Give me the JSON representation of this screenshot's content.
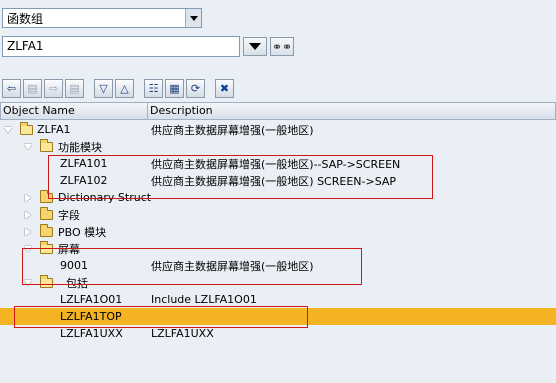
{
  "object_type": {
    "selected": "函数组"
  },
  "object_name": {
    "value": "ZLFA1"
  },
  "toolbar": {
    "icons": [
      "back-icon",
      "forward-dim-icon",
      "forward-icon",
      "forward-dim2-icon",
      "collapse-icon",
      "expand-icon",
      "hierarchy-icon",
      "display-icon",
      "refresh-icon",
      "close-icon"
    ]
  },
  "columns": {
    "name": "Object Name",
    "description": "Description"
  },
  "tree": {
    "root": {
      "name": "ZLFA1",
      "desc": "供应商主数据屏幕增强(一般地区)"
    },
    "function_modules": {
      "name": "功能模块"
    },
    "fm1": {
      "name": "ZLFA101",
      "desc": "供应商主数据屏幕增强(一般地区)--SAP->SCREEN"
    },
    "fm2": {
      "name": "ZLFA102",
      "desc": "供应商主数据屏幕增强(一般地区)  SCREEN->SAP"
    },
    "dictionary": {
      "name": "Dictionary Struct"
    },
    "fields": {
      "name": "字段"
    },
    "pbo": {
      "name": "PBO 模块"
    },
    "screens": {
      "name": "屏幕"
    },
    "screen1": {
      "name": "9001",
      "desc": "供应商主数据屏幕增强(一般地区)"
    },
    "includes": {
      "name": "包括"
    },
    "inc1": {
      "name": "LZLFA1O01",
      "desc": "Include LZLFA1O01"
    },
    "inc2": {
      "name": "LZLFA1TOP",
      "desc": ""
    },
    "inc3": {
      "name": "LZLFA1UXX",
      "desc": "LZLFA1UXX"
    }
  },
  "colors": {
    "highlight": "#f3b322",
    "annotation": "#d11616"
  }
}
